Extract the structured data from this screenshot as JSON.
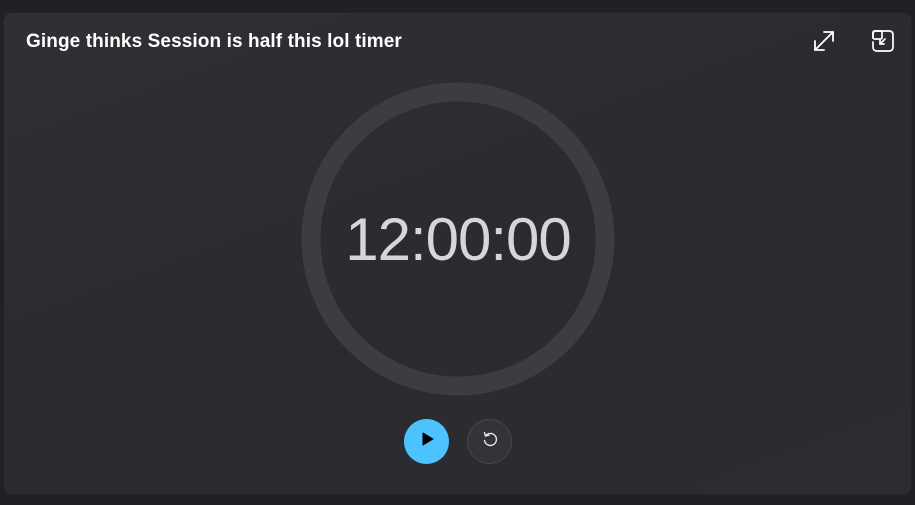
{
  "window": {
    "title": "Ginge thinks Session is half this lol timer"
  },
  "toolbar": {
    "expand_icon": "expand-diagonal-icon",
    "compact_overlay_icon": "picture-in-picture-icon"
  },
  "timer": {
    "display": "12:00:00",
    "progress": 0
  },
  "controls": {
    "play_icon": "play-icon",
    "reset_icon": "reset-icon"
  },
  "colors": {
    "accent": "#4cc2ff",
    "background": "#2f3034",
    "ring": "#3c3d41",
    "time_text": "#d6d6d8"
  }
}
